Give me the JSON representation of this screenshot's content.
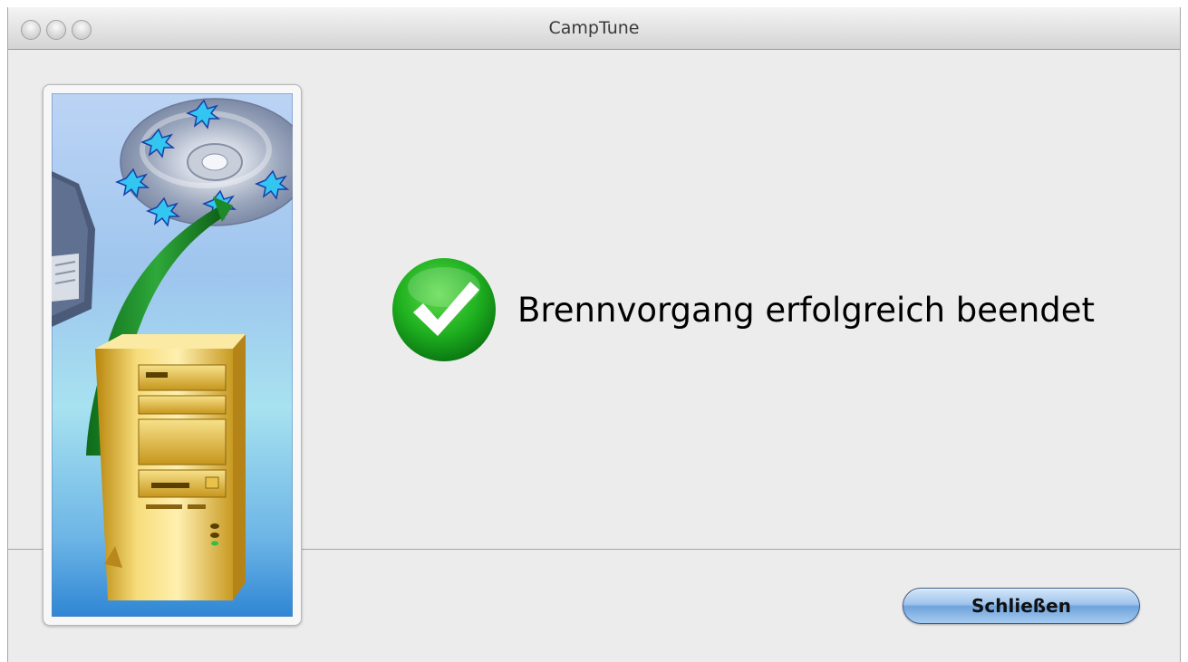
{
  "window": {
    "title": "CampTune"
  },
  "dialog": {
    "message": "Brennvorgang erfolgreich beendet",
    "close_label": "Schließen"
  },
  "icons": {
    "traffic_lights": [
      "close-window-icon",
      "minimize-window-icon",
      "zoom-window-icon"
    ],
    "status": "success-checkmark-icon",
    "illustration": "burn-disc-to-computer-illustration"
  },
  "colors": {
    "window_background": "#ececec",
    "check_green": "#1fb020",
    "button_blue": "#8fbbe8"
  }
}
